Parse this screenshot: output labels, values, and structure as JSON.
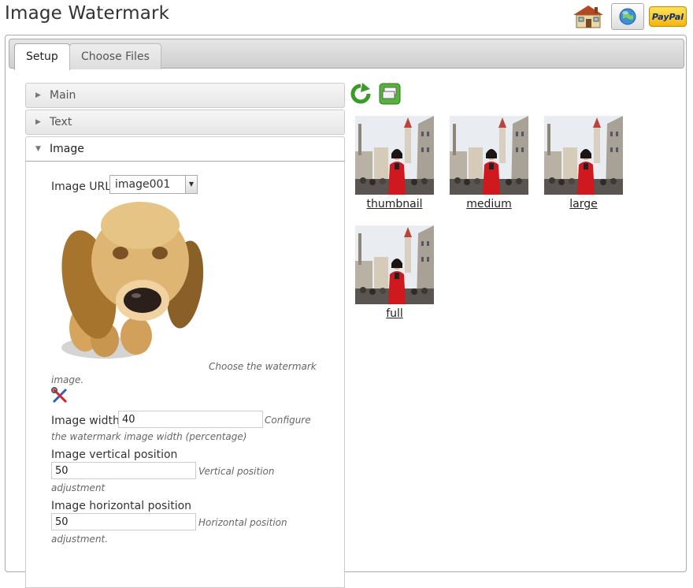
{
  "header": {
    "title": "Image Watermark"
  },
  "top_icons": [
    {
      "name": "home-icon"
    },
    {
      "name": "website-icon"
    },
    {
      "name": "paypal-icon",
      "label": "PayPal"
    }
  ],
  "tabs": [
    {
      "label": "Setup",
      "active": true
    },
    {
      "label": "Choose Files",
      "active": false
    }
  ],
  "accordion": {
    "main": "Main",
    "text": "Text",
    "image": "Image"
  },
  "image_section": {
    "url_label": "Image URL",
    "url_selected": "image001",
    "watermark_help": "Choose the watermark",
    "watermark_help_2": "image.",
    "width_label": "Image width",
    "width_value": "40",
    "width_help": "Configure",
    "width_help_2": "the watermark image width (percentage)",
    "vertical_label": "Image vertical position",
    "vertical_value": "50",
    "vertical_help": "Vertical position",
    "vertical_help_2": "adjustment",
    "horizontal_label": "Image horizontal position",
    "horizontal_value": "50",
    "horizontal_help": "Horizontal position",
    "horizontal_help_2": "adjustment."
  },
  "previews": [
    {
      "label": "thumbnail"
    },
    {
      "label": "medium"
    },
    {
      "label": "large"
    },
    {
      "label": "full"
    }
  ],
  "colors": {
    "accent_green": "#3a9b2a",
    "paypal_yellow": "#f7b30d",
    "coat_red": "#d0181f"
  }
}
